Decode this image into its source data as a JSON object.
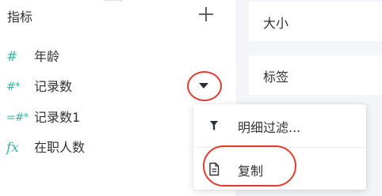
{
  "sidebar": {
    "title": "指标",
    "add_icon": "plus-icon",
    "fields": [
      {
        "icon": "#",
        "icon_name": "numeric-hash-icon",
        "label": "年龄"
      },
      {
        "icon": "#*",
        "icon_name": "calculated-hash-icon",
        "label": "记录数"
      },
      {
        "icon": "=#*",
        "icon_name": "derived-hash-icon",
        "label": "记录数1"
      },
      {
        "icon": "fx",
        "icon_name": "formula-icon",
        "label": "在职人数"
      }
    ],
    "dropdown_icon": "caret-down-icon"
  },
  "right_panel": {
    "slots": [
      {
        "label": "大小"
      },
      {
        "label": "标签"
      }
    ]
  },
  "context_menu": {
    "items": [
      {
        "icon_name": "filter-icon",
        "label": "明细过滤..."
      },
      {
        "icon_name": "copy-document-icon",
        "label": "复制"
      }
    ]
  },
  "colors": {
    "field_icon": "#39b6a5",
    "annotation_red": "#e23a2c",
    "panel_bg": "#f3f5f8"
  }
}
